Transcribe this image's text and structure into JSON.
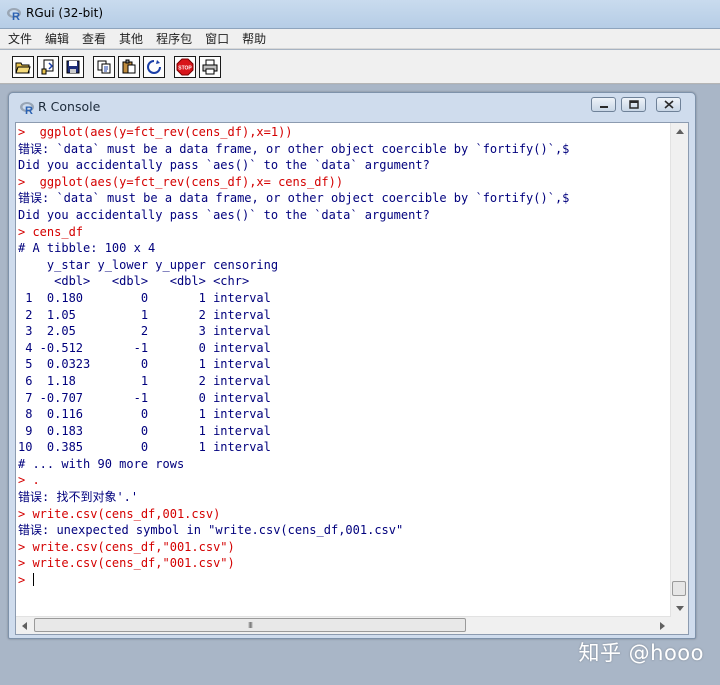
{
  "app": {
    "title": "RGui (32-bit)"
  },
  "menu": [
    "文件",
    "编辑",
    "查看",
    "其他",
    "程序包",
    "窗口",
    "帮助"
  ],
  "toolbar": {
    "buttons": [
      {
        "name": "open-script-icon"
      },
      {
        "name": "load-workspace-icon"
      },
      {
        "name": "save-workspace-icon"
      },
      {
        "name": "copy-icon"
      },
      {
        "name": "paste-icon"
      },
      {
        "name": "copy-paste-icon"
      },
      {
        "name": "stop-icon",
        "label": "STOP"
      },
      {
        "name": "print-icon"
      }
    ]
  },
  "console": {
    "title": "R Console",
    "lines": [
      {
        "type": "input",
        "text": ">  ggplot(aes(y=fct_rev(cens_df),x=1))"
      },
      {
        "type": "output",
        "text": "错误: `data` must be a data frame, or other object coercible by `fortify()`,$"
      },
      {
        "type": "output",
        "text": "Did you accidentally pass `aes()` to the `data` argument?"
      },
      {
        "type": "input",
        "text": ">  ggplot(aes(y=fct_rev(cens_df),x= cens_df))"
      },
      {
        "type": "output",
        "text": "错误: `data` must be a data frame, or other object coercible by `fortify()`,$"
      },
      {
        "type": "output",
        "text": "Did you accidentally pass `aes()` to the `data` argument?"
      },
      {
        "type": "input",
        "text": "> cens_df"
      },
      {
        "type": "output",
        "text": "# A tibble: 100 x 4"
      },
      {
        "type": "output",
        "text": "    y_star y_lower y_upper censoring"
      },
      {
        "type": "output",
        "text": "     <dbl>   <dbl>   <dbl> <chr>"
      },
      {
        "type": "output",
        "text": " 1  0.180        0       1 interval"
      },
      {
        "type": "output",
        "text": " 2  1.05         1       2 interval"
      },
      {
        "type": "output",
        "text": " 3  2.05         2       3 interval"
      },
      {
        "type": "output",
        "text": " 4 -0.512       -1       0 interval"
      },
      {
        "type": "output",
        "text": " 5  0.0323       0       1 interval"
      },
      {
        "type": "output",
        "text": " 6  1.18         1       2 interval"
      },
      {
        "type": "output",
        "text": " 7 -0.707       -1       0 interval"
      },
      {
        "type": "output",
        "text": " 8  0.116        0       1 interval"
      },
      {
        "type": "output",
        "text": " 9  0.183        0       1 interval"
      },
      {
        "type": "output",
        "text": "10  0.385        0       1 interval"
      },
      {
        "type": "output",
        "text": "# ... with 90 more rows"
      },
      {
        "type": "input",
        "text": "> ."
      },
      {
        "type": "output",
        "text": "错误: 找不到对象'.'"
      },
      {
        "type": "input",
        "text": "> write.csv(cens_df,001.csv)"
      },
      {
        "type": "output",
        "text": "错误: unexpected symbol in \"write.csv(cens_df,001.csv\""
      },
      {
        "type": "input",
        "text": "> write.csv(cens_df,\"001.csv\")"
      },
      {
        "type": "input",
        "text": "> write.csv(cens_df,\"001.csv\")"
      }
    ],
    "prompt": "> ",
    "scrollbar_h_grip": "III"
  },
  "watermark": "知乎 @hooo",
  "colors": {
    "input_text": "#d40000",
    "output_text": "#00007d",
    "stop_red": "#d8141a"
  }
}
